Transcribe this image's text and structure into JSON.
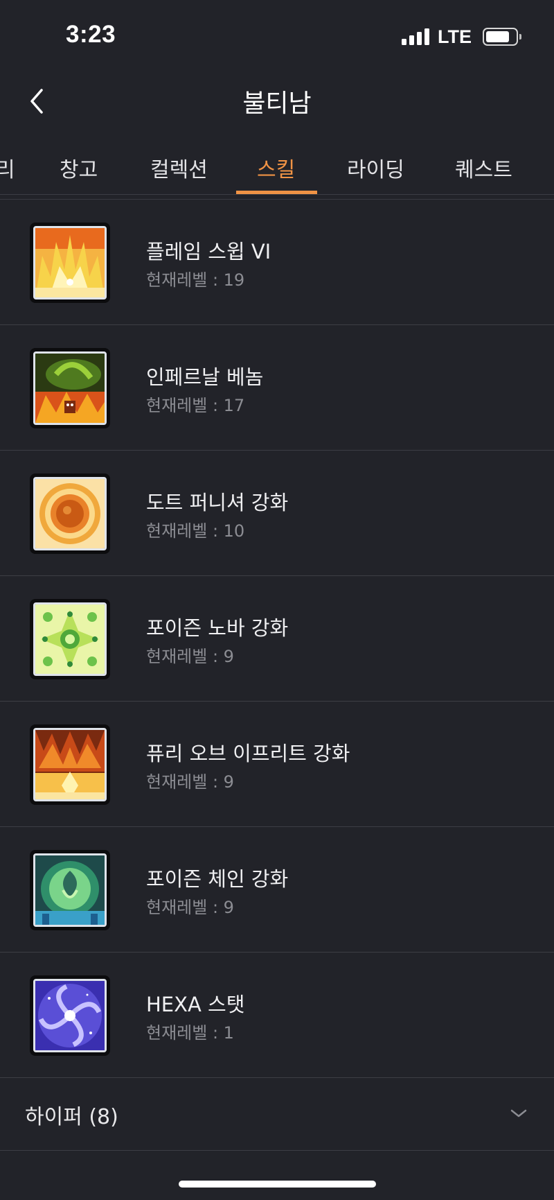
{
  "status_bar": {
    "time": "3:23",
    "network": "LTE"
  },
  "header": {
    "title": "불티남"
  },
  "tabs": [
    {
      "label": "리",
      "active": false
    },
    {
      "label": "창고",
      "active": false
    },
    {
      "label": "컬렉션",
      "active": false
    },
    {
      "label": "스킬",
      "active": true
    },
    {
      "label": "라이딩",
      "active": false
    },
    {
      "label": "퀘스트",
      "active": false
    }
  ],
  "skills": [
    {
      "name": "플레임 스윕 VI",
      "level": "현재레벨 : 19",
      "icon": "flame-sweep-icon"
    },
    {
      "name": "인페르날 베놈",
      "level": "현재레벨 : 17",
      "icon": "infernal-venom-icon"
    },
    {
      "name": "도트 퍼니셔 강화",
      "level": "현재레벨 : 10",
      "icon": "dot-punisher-icon"
    },
    {
      "name": "포이즌 노바 강화",
      "level": "현재레벨 : 9",
      "icon": "poison-nova-icon"
    },
    {
      "name": "퓨리 오브 이프리트 강화",
      "level": "현재레벨 : 9",
      "icon": "fury-of-ifrit-icon"
    },
    {
      "name": "포이즌 체인 강화",
      "level": "현재레벨 : 9",
      "icon": "poison-chain-icon"
    },
    {
      "name": "HEXA 스탯",
      "level": "현재레벨 : 1",
      "icon": "hexa-stat-icon"
    }
  ],
  "group": {
    "label": "하이퍼 (8)"
  },
  "colors": {
    "background": "#222329",
    "accent": "#f09345",
    "divider": "#3d3e45",
    "secondary_text": "#8c8d93"
  }
}
